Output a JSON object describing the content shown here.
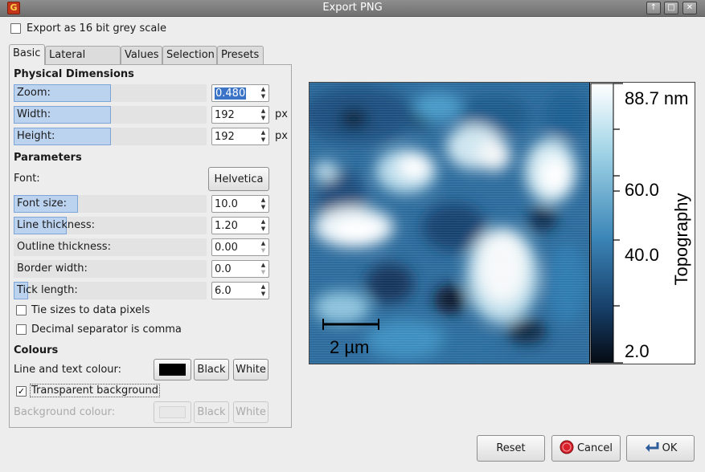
{
  "window": {
    "title": "Export PNG",
    "app_icon_glyph": "G",
    "controls": [
      "↑",
      "□",
      "✕"
    ]
  },
  "export_16bit": {
    "label": "Export as 16 bit grey scale",
    "checked": false
  },
  "tabs": [
    {
      "label": "Basic",
      "active": true
    },
    {
      "label": "Lateral Scale",
      "active": false
    },
    {
      "label": "Values",
      "active": false
    },
    {
      "label": "Selection",
      "active": false
    },
    {
      "label": "Presets",
      "active": false
    }
  ],
  "physical": {
    "heading": "Physical Dimensions",
    "zoom": {
      "label": "Zoom:",
      "value": "0.480"
    },
    "width": {
      "label": "Width:",
      "value": "192",
      "unit": "px"
    },
    "height": {
      "label": "Height:",
      "value": "192",
      "unit": "px"
    }
  },
  "parameters": {
    "heading": "Parameters",
    "font": {
      "label": "Font:",
      "value": "Helvetica"
    },
    "font_size": {
      "label": "Font size:",
      "value": "10.0"
    },
    "line_thickness": {
      "label": "Line thickness:",
      "value": "1.20"
    },
    "outline_thickness": {
      "label": "Outline thickness:",
      "value": "0.00"
    },
    "border_width": {
      "label": "Border width:",
      "value": "0.0"
    },
    "tick_length": {
      "label": "Tick length:",
      "value": "6.0"
    },
    "tie_sizes": {
      "label": "Tie sizes to data pixels",
      "checked": false
    },
    "decimal_comma": {
      "label": "Decimal separator is comma",
      "checked": false
    }
  },
  "colours": {
    "heading": "Colours",
    "line_text": {
      "label": "Line and text colour:",
      "color": "#000000"
    },
    "black_label": "Black",
    "white_label": "White",
    "transparent_bg": {
      "label": "Transparent background",
      "checked": true
    },
    "background": {
      "label": "Background colour:",
      "color": "#e8e8e8"
    }
  },
  "preview": {
    "scale_bar_label": "2 µm",
    "colorbar_title": "Topography",
    "colorbar_ticks": [
      "88.7 nm",
      "60.0",
      "40.0",
      "2.0"
    ]
  },
  "buttons": {
    "reset": "Reset",
    "cancel": "Cancel",
    "ok": "OK"
  },
  "colors": {
    "selection": "#3b74c6",
    "bar_fill": "#bcd3f0",
    "cancel_icon": "#d8202a"
  },
  "icons": {
    "cancel": "stop-sign-icon",
    "ok": "return-arrow-icon"
  }
}
